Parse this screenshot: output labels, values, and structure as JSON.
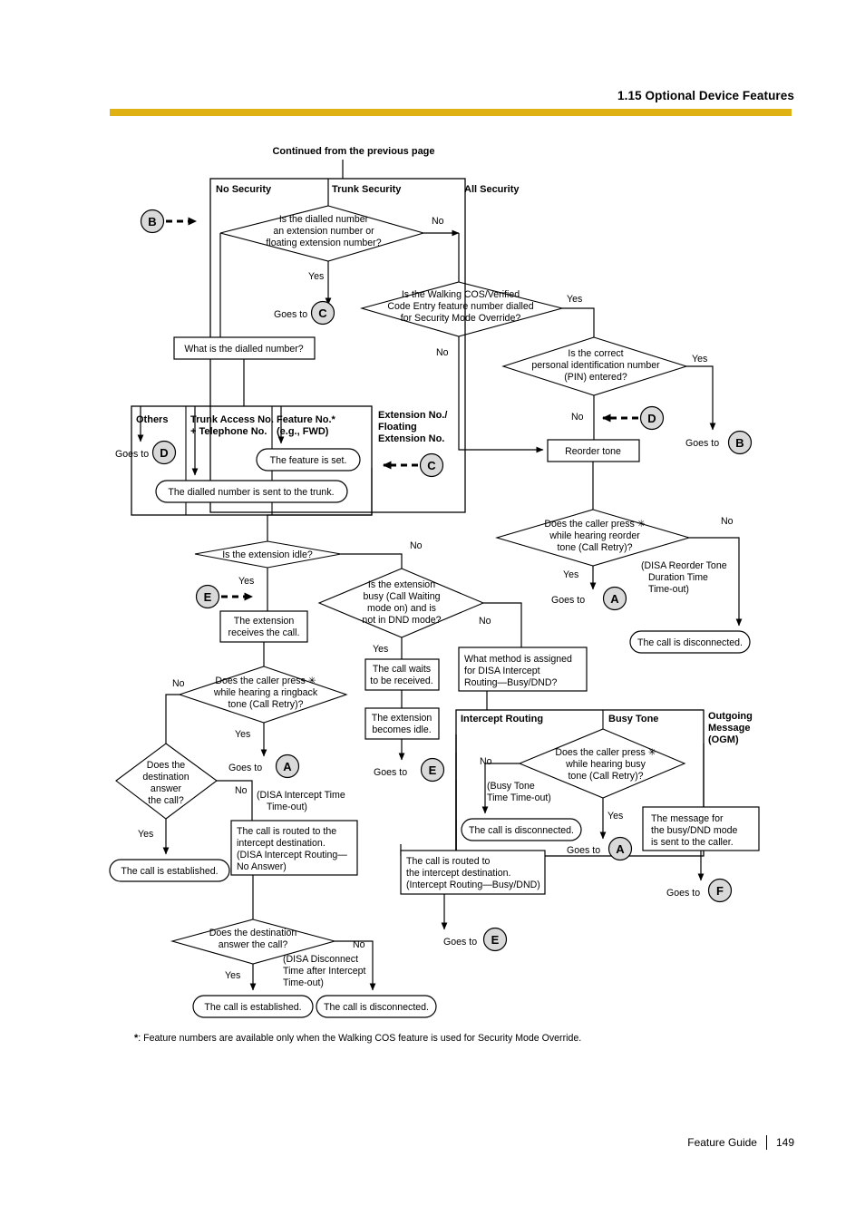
{
  "header": {
    "title": "1.15 Optional Device Features",
    "rule_color": "#dfb113"
  },
  "footer": {
    "guide": "Feature Guide",
    "page": "149"
  },
  "footnote": {
    "marker": "*",
    "text": ": Feature numbers are available only when the Walking COS feature is used for Security Mode Override."
  },
  "diagram": {
    "top_label": "Continued from the previous page",
    "security_group": {
      "no_security": "No Security",
      "trunk_security": "Trunk Security",
      "all_security": "All Security"
    },
    "dialled_group": {
      "others": "Others",
      "trunk_access": "Trunk Access No.",
      "trunk_access_2": "+ Telephone  No.",
      "feature_no": "Feature No.*",
      "feature_eg": "(e.g., FWD)",
      "ext_1": "Extension No./",
      "ext_2": "Floating",
      "ext_3": "Extension No."
    },
    "method_group": {
      "intercept_routing": "Intercept Routing",
      "busy_tone": "Busy Tone",
      "ogm_1": "Outgoing",
      "ogm_2": "Message",
      "ogm_3": "(OGM)"
    },
    "decisions": {
      "d1_l1": "Is the dialled number",
      "d1_l2": "an extension number or",
      "d1_l3": "floating extension number?",
      "d2_l1": "Is the Walking COS/Verified",
      "d2_l2": "Code Entry feature number dialled",
      "d2_l3": "for Security Mode Override?",
      "d3_l1": "Is the correct",
      "d3_l2": "personal identification number",
      "d3_l3": "(PIN)  entered?",
      "d4_l1": "Does the caller press ✳",
      "d4_l2": "while hearing reorder",
      "d4_l3": "tone (Call Retry)?",
      "d5_l1": "Is the extension idle?",
      "d6_l1": "Is the extension",
      "d6_l2": "busy (Call Waiting",
      "d6_l3": "mode on) and is",
      "d6_l4": "not  in DND mode?",
      "d7_l1": "Does the caller press ✳",
      "d7_l2": "while hearing a ringback",
      "d7_l3": "tone (Call Retry)?",
      "d8_l1": "Does the",
      "d8_l2": "destination",
      "d8_l3": "answer",
      "d8_l4": "the call?",
      "d9_l1": "Does the destination",
      "d9_l2": "answer the call?",
      "d10_l1": "Does the caller press ✳",
      "d10_l2": "while hearing busy",
      "d10_l3": "tone (Call Retry)?"
    },
    "processes": {
      "p_what_dialled": "What is the dialled number?",
      "p_reorder": "Reorder tone",
      "p_ext_receives_1": "The extension",
      "p_ext_receives_2": "receives the call.",
      "p_call_waits_1": "The call waits",
      "p_call_waits_2": "to be received.",
      "p_ext_idle_1": "The extension",
      "p_ext_idle_2": "becomes idle.",
      "p_method_1": "What method is assigned",
      "p_method_2": "for DISA Intercept",
      "p_method_3": "Routing—Busy/DND?",
      "p_routed_na_1": "The call is routed to the",
      "p_routed_na_2": "intercept destination.",
      "p_routed_na_3": "(DISA Intercept Routing—",
      "p_routed_na_4": "No Answer)",
      "p_routed_bd_1": "The call is routed to",
      "p_routed_bd_2": "the intercept destination.",
      "p_routed_bd_3": "(Intercept Routing—Busy/DND)",
      "p_msg_1": "The message for",
      "p_msg_2": "the busy/DND mode",
      "p_msg_3": "is sent to the caller."
    },
    "terminals": {
      "t_feature_set": "The feature is set.",
      "t_sent_trunk": "The dialled number is sent to the trunk.",
      "t_disc_1": "The call is disconnected.",
      "t_est_1": "The call is established.",
      "t_disc_2": "The call is disconnected.",
      "t_est_2": "The call is established.",
      "t_disc_3": "The call is disconnected."
    },
    "labels": {
      "yes": "Yes",
      "no": "No",
      "goes_to": "Goes to",
      "note_reorder_1": "(DISA Reorder Tone",
      "note_reorder_2": "Duration Time",
      "note_reorder_3": "Time-out)",
      "note_intercept_1": "(DISA Intercept Time",
      "note_intercept_2": "Time-out)",
      "note_disconnect_1": "(DISA Disconnect",
      "note_disconnect_2": "Time after Intercept",
      "note_disconnect_3": "Time-out)",
      "note_busytone_1": "(Busy Tone",
      "note_busytone_2": "Time Time-out)"
    },
    "connectors": {
      "A": "A",
      "B": "B",
      "C": "C",
      "D": "D",
      "E": "E",
      "F": "F"
    }
  }
}
